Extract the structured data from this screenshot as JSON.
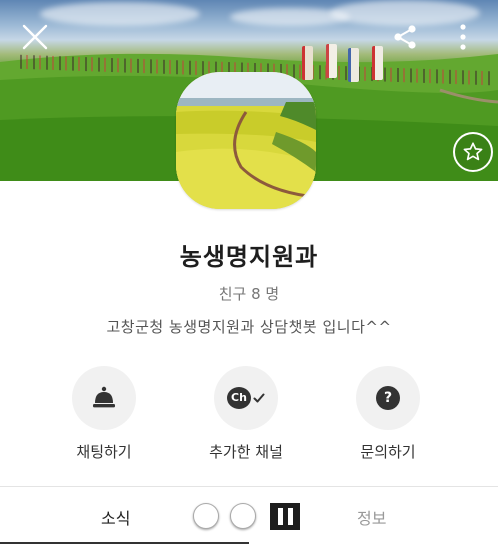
{
  "header": {
    "close_icon": "close-icon",
    "share_icon": "share-icon",
    "more_icon": "more-vertical-icon",
    "favorite_icon": "star-icon"
  },
  "profile": {
    "name": "농생명지원과",
    "friends": "친구 8 명",
    "description": "고창군청 농생명지원과 상담챗봇 입니다^^"
  },
  "actions": [
    {
      "label": "채팅하기",
      "icon": "bell-icon"
    },
    {
      "label": "추가한 채널",
      "icon": "channel-check-icon",
      "icon_text": "Ch"
    },
    {
      "label": "문의하기",
      "icon": "question-icon",
      "icon_text": "?"
    }
  ],
  "tabs": [
    {
      "label": "소식",
      "active": true
    },
    {
      "label": "정보",
      "active": false
    }
  ],
  "colors": {
    "accent_text": "#1e1e1e",
    "muted_text": "#777777",
    "button_bg": "#f1f1f1",
    "icon_dark": "#333333"
  }
}
